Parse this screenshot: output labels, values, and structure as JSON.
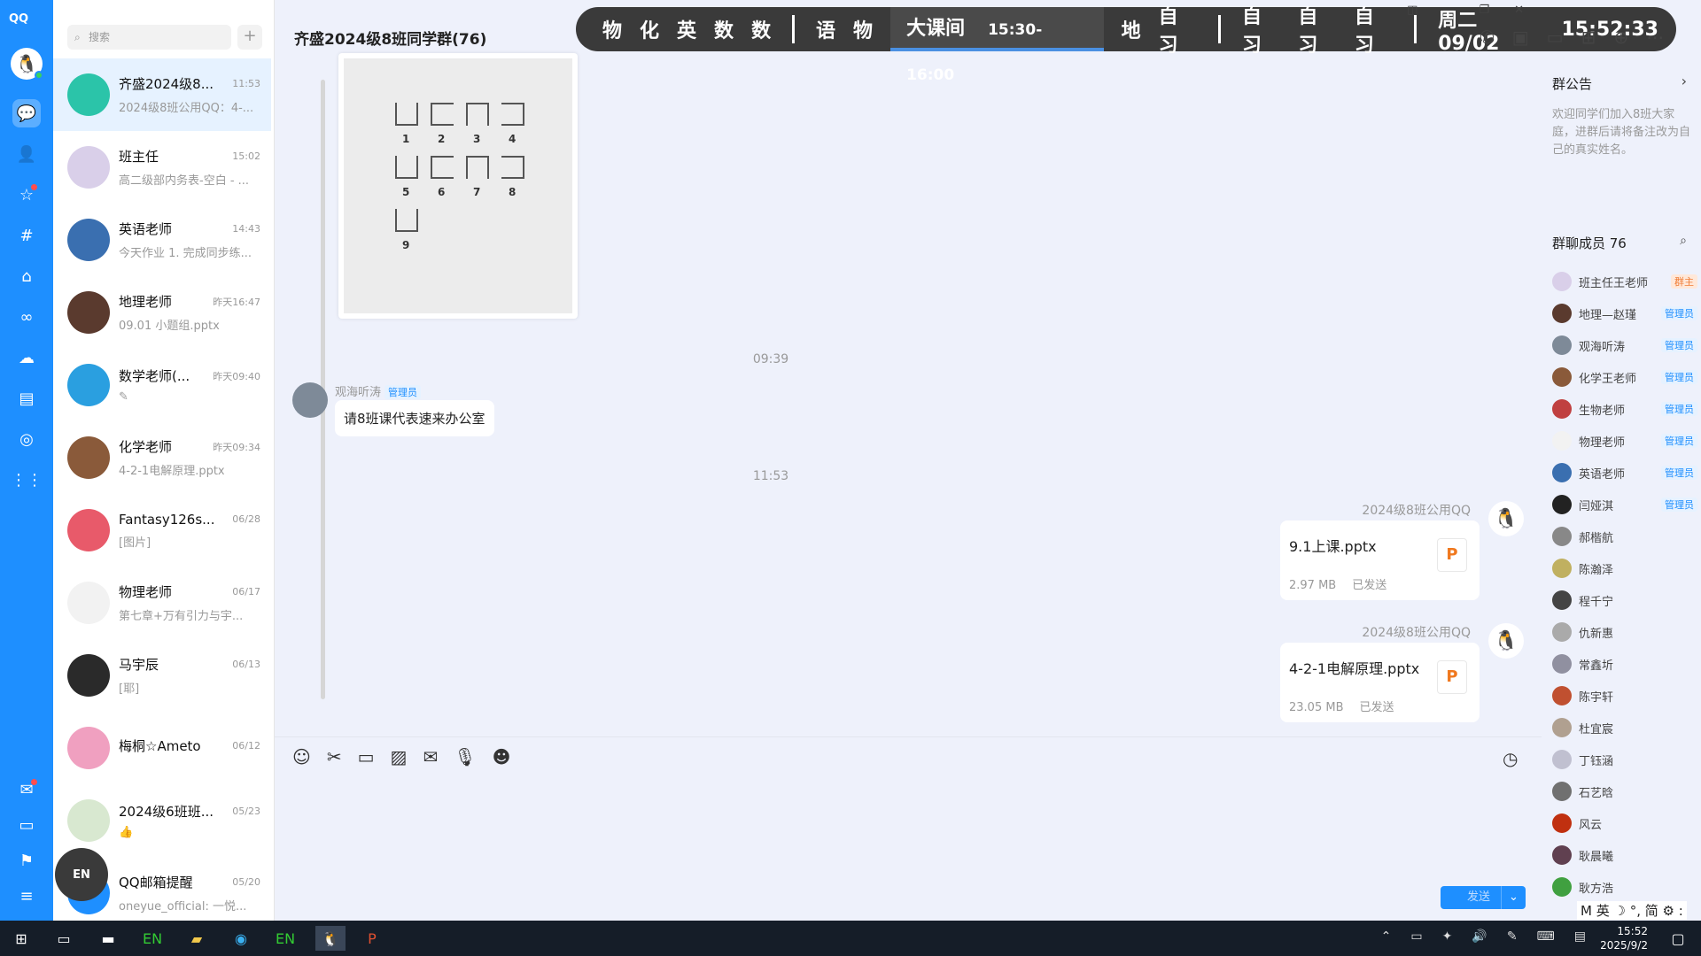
{
  "app": {
    "logo": "QQ"
  },
  "search": {
    "placeholder": "搜索"
  },
  "chats": [
    {
      "name": "齐盛2024级8...",
      "time": "11:53",
      "preview": "2024级8班公用QQ：4-...",
      "color": "#2bc4a9",
      "selected": true
    },
    {
      "name": "班主任",
      "time": "15:02",
      "preview": "高二级部内务表-空白 - ...",
      "color": "#d9cfe9"
    },
    {
      "name": "英语老师",
      "time": "14:43",
      "preview": "今天作业 1. 完成同步练...",
      "color": "#3a6fb0"
    },
    {
      "name": "地理老师",
      "time": "昨天16:47",
      "preview": "09.01 小题组.pptx",
      "color": "#5a3a2e"
    },
    {
      "name": "数学老师(...",
      "time": "昨天09:40",
      "preview": "✎",
      "color": "#2a9fe0"
    },
    {
      "name": "化学老师",
      "time": "昨天09:34",
      "preview": "4-2-1电解原理.pptx",
      "color": "#8a5a3a"
    },
    {
      "name": "Fantasy126s...",
      "time": "06/28",
      "preview": "[图片]",
      "color": "#e85a6a"
    },
    {
      "name": "物理老师",
      "time": "06/17",
      "preview": "第七章+万有引力与宇...",
      "color": "#f2f2f2"
    },
    {
      "name": "马宇辰",
      "time": "06/13",
      "preview": "[耶]",
      "color": "#2a2a2a"
    },
    {
      "name": "梅桐☆Ameto",
      "time": "06/12",
      "preview": "",
      "color": "#f0a0c0"
    },
    {
      "name": "2024级6班班...",
      "time": "05/23",
      "preview": "👍",
      "color": "#d8e8d0"
    },
    {
      "name": "QQ邮箱提醒",
      "time": "05/20",
      "preview": "oneyue_official: 一悦...",
      "color": "#1e8fff"
    }
  ],
  "chat": {
    "title": "齐盛2024级8班同学群(76)",
    "topbar": {
      "subjects1": [
        "物",
        "化",
        "英",
        "数",
        "数"
      ],
      "subjects2": [
        "语",
        "物"
      ],
      "current_label": "大课间",
      "current_time": "15:30-16:00",
      "subjects3": [
        "地",
        "自习"
      ],
      "subjects4": [
        "自习",
        "自习",
        "自习"
      ],
      "date": "周二 09/02",
      "clock": "15:52:33"
    },
    "image_numbers": [
      "1",
      "2",
      "3",
      "4",
      "5",
      "6",
      "7",
      "8",
      "9"
    ],
    "ts1": "09:39",
    "in_msg": {
      "sender": "观海听涛",
      "badge": "管理员",
      "text": "请8班课代表速来办公室"
    },
    "ts2": "11:53",
    "out_msgs": [
      {
        "sender": "2024级8班公用QQ",
        "file": "9.1上课.pptx",
        "size": "2.97 MB",
        "status": "已发送"
      },
      {
        "sender": "2024级8班公用QQ",
        "file": "4-2-1电解原理.pptx",
        "size": "23.05 MB",
        "status": "已发送"
      }
    ],
    "send_label": "发送"
  },
  "panel": {
    "notice_title": "群公告",
    "notice_text": "欢迎同学们加入8班大家庭，进群后请将备注改为自己的真实姓名。",
    "members_title": "群聊成员 76",
    "members": [
      {
        "name": "班主任王老师",
        "tag": "群主",
        "owner": true,
        "color": "#d9cfe9"
      },
      {
        "name": "地理—赵瑾",
        "tag": "管理员",
        "color": "#5a3a2e"
      },
      {
        "name": "观海听涛",
        "tag": "管理员",
        "color": "#7e8a98"
      },
      {
        "name": "化学王老师",
        "tag": "管理员",
        "color": "#8a5a3a"
      },
      {
        "name": "生物老师",
        "tag": "管理员",
        "color": "#c04040"
      },
      {
        "name": "物理老师",
        "tag": "管理员",
        "color": "#f2f2f2"
      },
      {
        "name": "英语老师",
        "tag": "管理员",
        "color": "#3a6fb0"
      },
      {
        "name": "闫娅淇",
        "tag": "管理员",
        "color": "#222"
      },
      {
        "name": "郝楷航",
        "tag": "",
        "color": "#888"
      },
      {
        "name": "陈瀚泽",
        "tag": "",
        "color": "#c0b060"
      },
      {
        "name": "程千宁",
        "tag": "",
        "color": "#444"
      },
      {
        "name": "仇新惠",
        "tag": "",
        "color": "#aaa"
      },
      {
        "name": "常鑫圻",
        "tag": "",
        "color": "#9090a0"
      },
      {
        "name": "陈宇轩",
        "tag": "",
        "color": "#c05030"
      },
      {
        "name": "杜宜宸",
        "tag": "",
        "color": "#b0a090"
      },
      {
        "name": "丁钰涵",
        "tag": "",
        "color": "#c0c0d0"
      },
      {
        "name": "石艺晗",
        "tag": "",
        "color": "#707070"
      },
      {
        "name": "风云",
        "tag": "",
        "color": "#c03010"
      },
      {
        "name": "耿晨曦",
        "tag": "",
        "color": "#604050"
      },
      {
        "name": "耿方浩",
        "tag": "",
        "color": "#40a040"
      }
    ]
  },
  "ime": "M 英 ☽ °, 简 ⚙ :",
  "float_label": "EN",
  "taskbar": {
    "time": "15:52",
    "date": "2025/9/2"
  }
}
